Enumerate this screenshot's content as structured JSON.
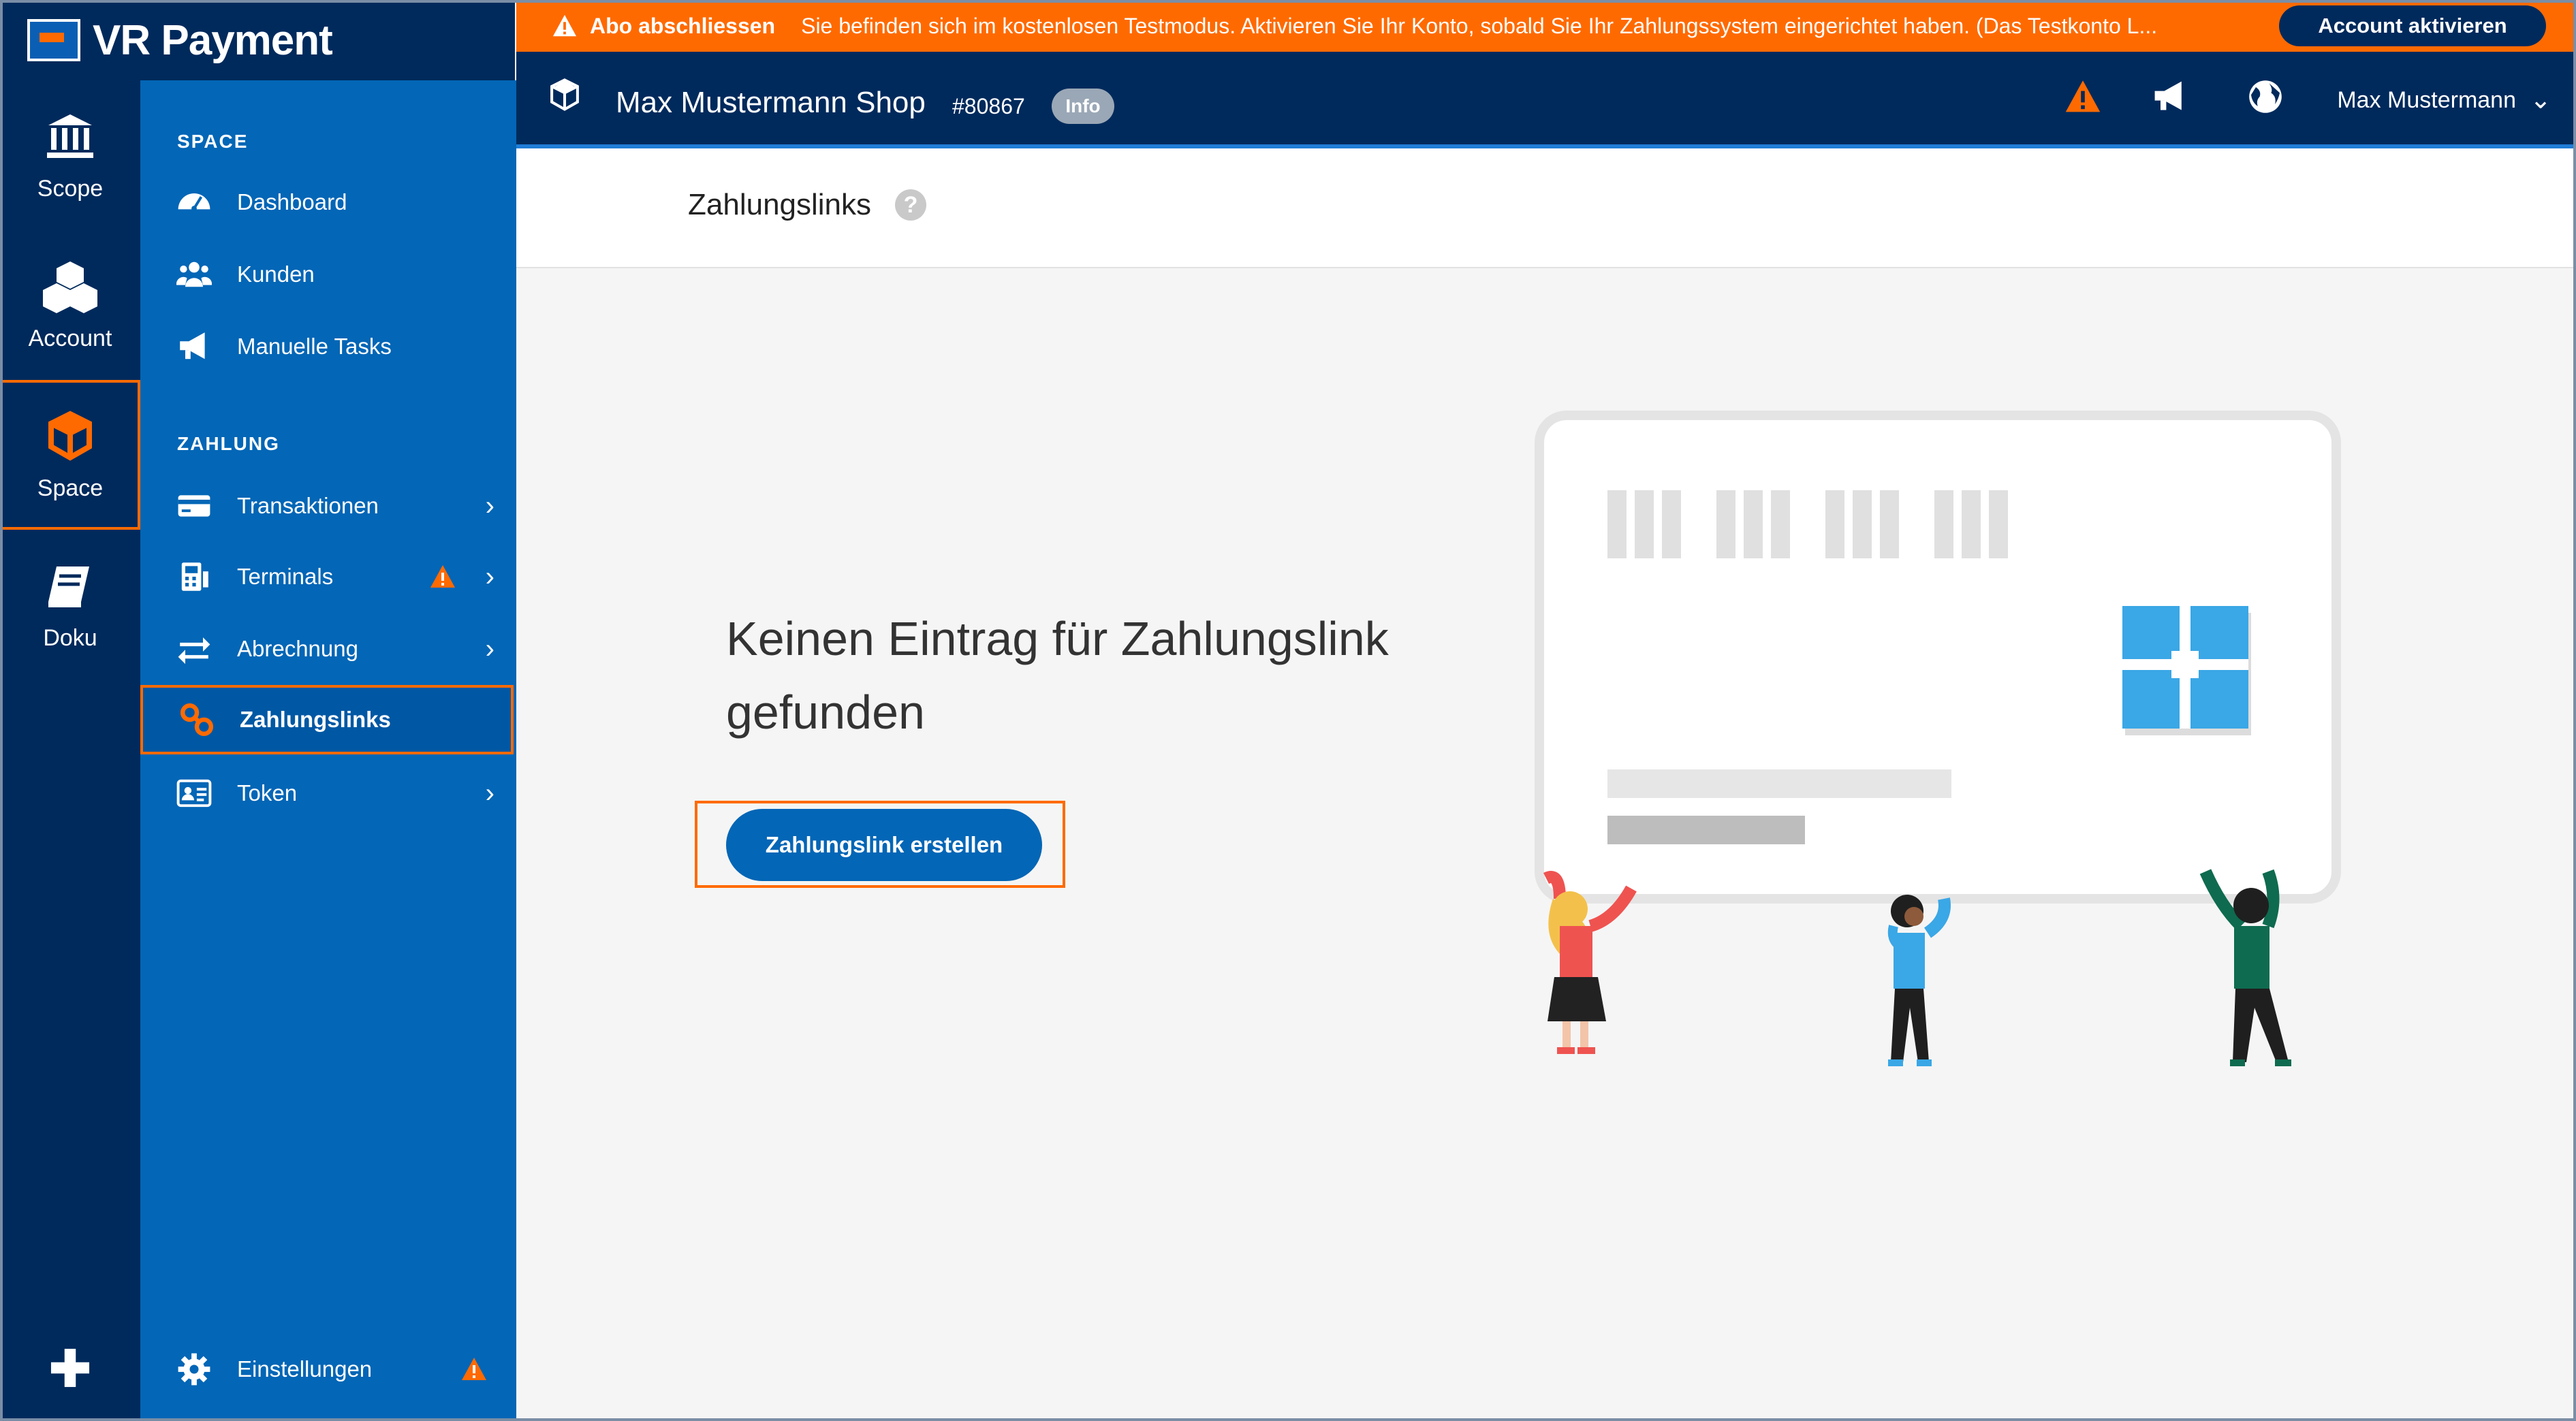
{
  "brand": {
    "name": "VR Payment"
  },
  "rail": {
    "items": [
      {
        "label": "Scope",
        "icon": "bank-icon"
      },
      {
        "label": "Account",
        "icon": "cubes-icon"
      },
      {
        "label": "Space",
        "icon": "cube-icon",
        "active": true
      },
      {
        "label": "Doku",
        "icon": "book-icon"
      }
    ],
    "add_icon": "plus-icon"
  },
  "sidebar": {
    "section_space": "SPACE",
    "section_zahlung": "ZAHLUNG",
    "items": [
      {
        "label": "Dashboard",
        "icon": "dashboard-icon"
      },
      {
        "label": "Kunden",
        "icon": "users-icon"
      },
      {
        "label": "Manuelle Tasks",
        "icon": "megaphone-icon"
      },
      {
        "label": "Transaktionen",
        "icon": "credit-card-icon",
        "has_submenu": true
      },
      {
        "label": "Terminals",
        "icon": "terminal-icon",
        "has_submenu": true,
        "warning": true
      },
      {
        "label": "Abrechnung",
        "icon": "exchange-icon",
        "has_submenu": true
      },
      {
        "label": "Zahlungslinks",
        "icon": "link-icon",
        "active": true
      },
      {
        "label": "Token",
        "icon": "id-card-icon",
        "has_submenu": true
      }
    ],
    "settings": {
      "label": "Einstellungen",
      "icon": "gear-icon",
      "warning": true
    }
  },
  "banner": {
    "strong": "Abo abschliessen",
    "message": "Sie befinden sich im kostenlosen Testmodus. Aktivieren Sie Ihr Konto, sobald Sie Ihr Zahlungssystem eingerichtet haben. (Das Testkonto L...",
    "button": "Account aktivieren",
    "color": "#ff6a00"
  },
  "header": {
    "shop_name": "Max Mustermann Shop",
    "shop_id": "#80867",
    "badge": "Info",
    "user": "Max Mustermann"
  },
  "page": {
    "title": "Zahlungslinks",
    "help": "?",
    "empty_heading_line1": "Keinen Eintrag für Zahlungslink",
    "empty_heading_line2": "gefunden",
    "create_button": "Zahlungslink erstellen"
  },
  "colors": {
    "navy": "#002a5c",
    "sidebar": "#0366b6",
    "accent": "#ff6a00",
    "background": "#f5f5f5"
  }
}
